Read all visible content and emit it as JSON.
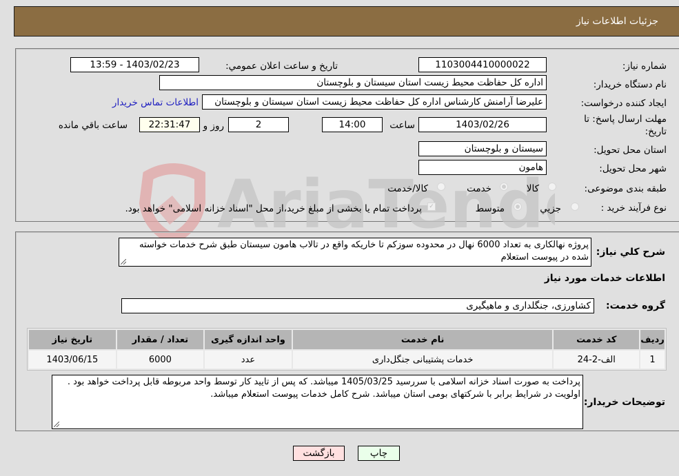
{
  "header": {
    "title": "جزئیات اطلاعات نیاز"
  },
  "form": {
    "need_number": {
      "label": "شماره نیاز:",
      "value": "1103004410000022"
    },
    "announce_datetime": {
      "label": "تاریخ و ساعت اعلان عمومي:",
      "value": "1403/02/23 - 13:59"
    },
    "buyer_org": {
      "label": "نام دستگاه خريدار:",
      "value": "اداره کل حفاظت محیط زیست استان سیستان و بلوچستان"
    },
    "requester": {
      "label": "ایجاد کننده درخواست:",
      "value": "علیرضا آرامنش کارشناس اداره کل حفاظت محیط زیست استان سیستان و بلوچستان",
      "contact_link": "اطلاعات تماس خریدار"
    },
    "deadline": {
      "label": "مهلت ارسال پاسخ: تا تاریخ:",
      "date": "1403/02/26",
      "time_label": "ساعت",
      "time": "14:00",
      "days": "2",
      "days_label": "روز و",
      "remaining": "22:31:47",
      "remaining_label": "ساعت باقي مانده"
    },
    "province": {
      "label": "استان محل تحویل:",
      "value": "سیستان و بلوچستان"
    },
    "city": {
      "label": "شهر محل تحویل:",
      "value": "هامون"
    },
    "category": {
      "label": "طبقه بندی موضوعی:",
      "options": [
        "کالا",
        "خدمت",
        "کالا/خدمت"
      ],
      "selected": "خدمت"
    },
    "purchase_type": {
      "label": "نوع فرآیند خرید :",
      "options": [
        "جزيي",
        "متوسط"
      ],
      "selected": "متوسط",
      "treasury_checkbox_label": "پرداخت تمام يا بخشی از مبلغ خرید،از محل \"اسناد خزانه اسلامی\" خواهد بود.",
      "treasury_checked": true
    }
  },
  "details": {
    "description_label": "شرح کلي نياز:",
    "description": "پروژه نهالکاری به تعداد 6000 نهال در محدوده سوزکم تا خاریکه واقع در تالاب هامون سیستان  طبق شرح خدمات خواسته شده در پیوست استعلام",
    "services_title": "اطلاعات خدمات مورد نیاز",
    "service_group_label": "گروه خدمت:",
    "service_group": "کشاورزی، جنگلداری و ماهیگیری",
    "table": {
      "headers": [
        "رديف",
        "کد خدمت",
        "نام خدمت",
        "واحد اندازه گیری",
        "تعداد / مقدار",
        "تاریخ نیاز"
      ],
      "rows": [
        [
          "1",
          "الف-2-24",
          "خدمات پشتیبانی جنگل‌داری",
          "عدد",
          "6000",
          "1403/06/15"
        ]
      ]
    },
    "buyer_notes_label": "توضیحات خریدار:",
    "buyer_notes": "پرداخت به صورت اسناد خزانه اسلامی با سررسید 1405/03/25 میباشد. که پس از تایید کار توسط واحد مربوطه قابل پرداخت خواهد بود . اولویت در شرایط برابر با شرکتهای بومی استان میباشد. شرح کامل خدمات پیوست استعلام میباشد."
  },
  "buttons": {
    "print": "چاپ",
    "back": "بازگشت"
  },
  "watermark": {
    "text": "AriaTender.neT"
  },
  "colors": {
    "header_bg": "#8b6d42",
    "back_btn": "#ffe0e0",
    "print_btn": "#eaffea",
    "link": "#2020c0"
  }
}
